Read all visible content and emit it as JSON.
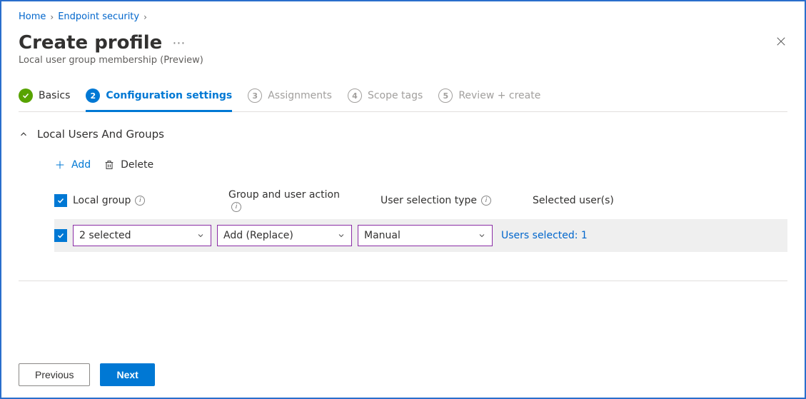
{
  "breadcrumb": {
    "home": "Home",
    "security": "Endpoint security"
  },
  "header": {
    "title": "Create profile",
    "subtitle": "Local user group membership (Preview)"
  },
  "wizard": {
    "step1": "Basics",
    "step2_num": "2",
    "step2": "Configuration settings",
    "step3_num": "3",
    "step3": "Assignments",
    "step4_num": "4",
    "step4": "Scope tags",
    "step5_num": "5",
    "step5": "Review + create"
  },
  "section": {
    "title": "Local Users And Groups"
  },
  "toolbar": {
    "add": "Add",
    "delete": "Delete"
  },
  "columns": {
    "local_group": "Local group",
    "group_action": "Group and user action",
    "user_sel_type": "User selection type",
    "selected_users": "Selected user(s)"
  },
  "row": {
    "local_group_value": "2 selected",
    "action_value": "Add (Replace)",
    "user_type_value": "Manual",
    "users_link": "Users selected: 1"
  },
  "footer": {
    "previous": "Previous",
    "next": "Next"
  }
}
